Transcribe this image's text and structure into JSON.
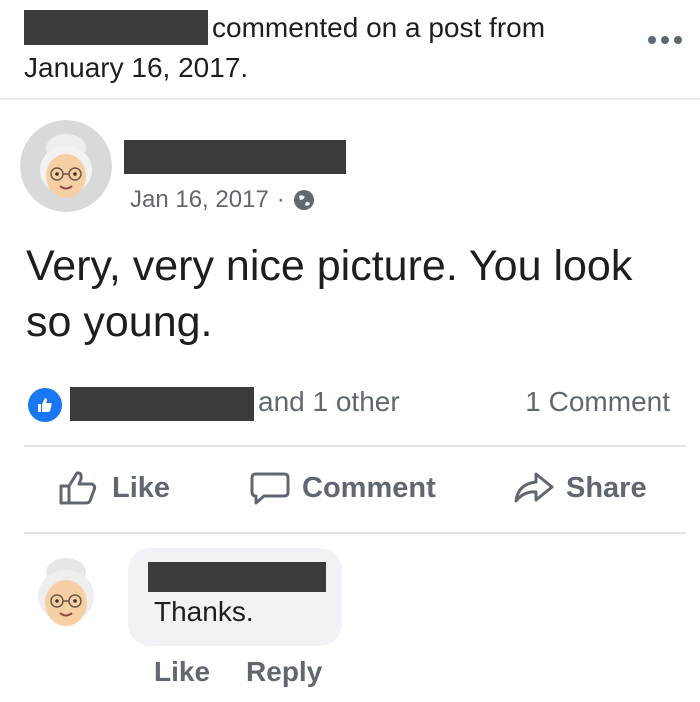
{
  "activity": {
    "action_text": "commented on a post from",
    "date_text": "January 16, 2017."
  },
  "post": {
    "date": "Jan 16, 2017",
    "separator": "·",
    "privacy_icon": "globe-icon",
    "text": "Very, very nice picture. You look so young.",
    "reactions": {
      "icon": "thumbs-up-icon",
      "others_text": "and 1 other",
      "comment_count_text": "1 Comment"
    },
    "actions": {
      "like_label": "Like",
      "comment_label": "Comment",
      "share_label": "Share"
    }
  },
  "comment": {
    "text": "Thanks.",
    "like_label": "Like",
    "reply_label": "Reply"
  },
  "colors": {
    "like_blue": "#1877f2",
    "muted_text": "#606770",
    "bubble_bg": "#f0f2f5",
    "redaction": "#3a3b3d"
  }
}
